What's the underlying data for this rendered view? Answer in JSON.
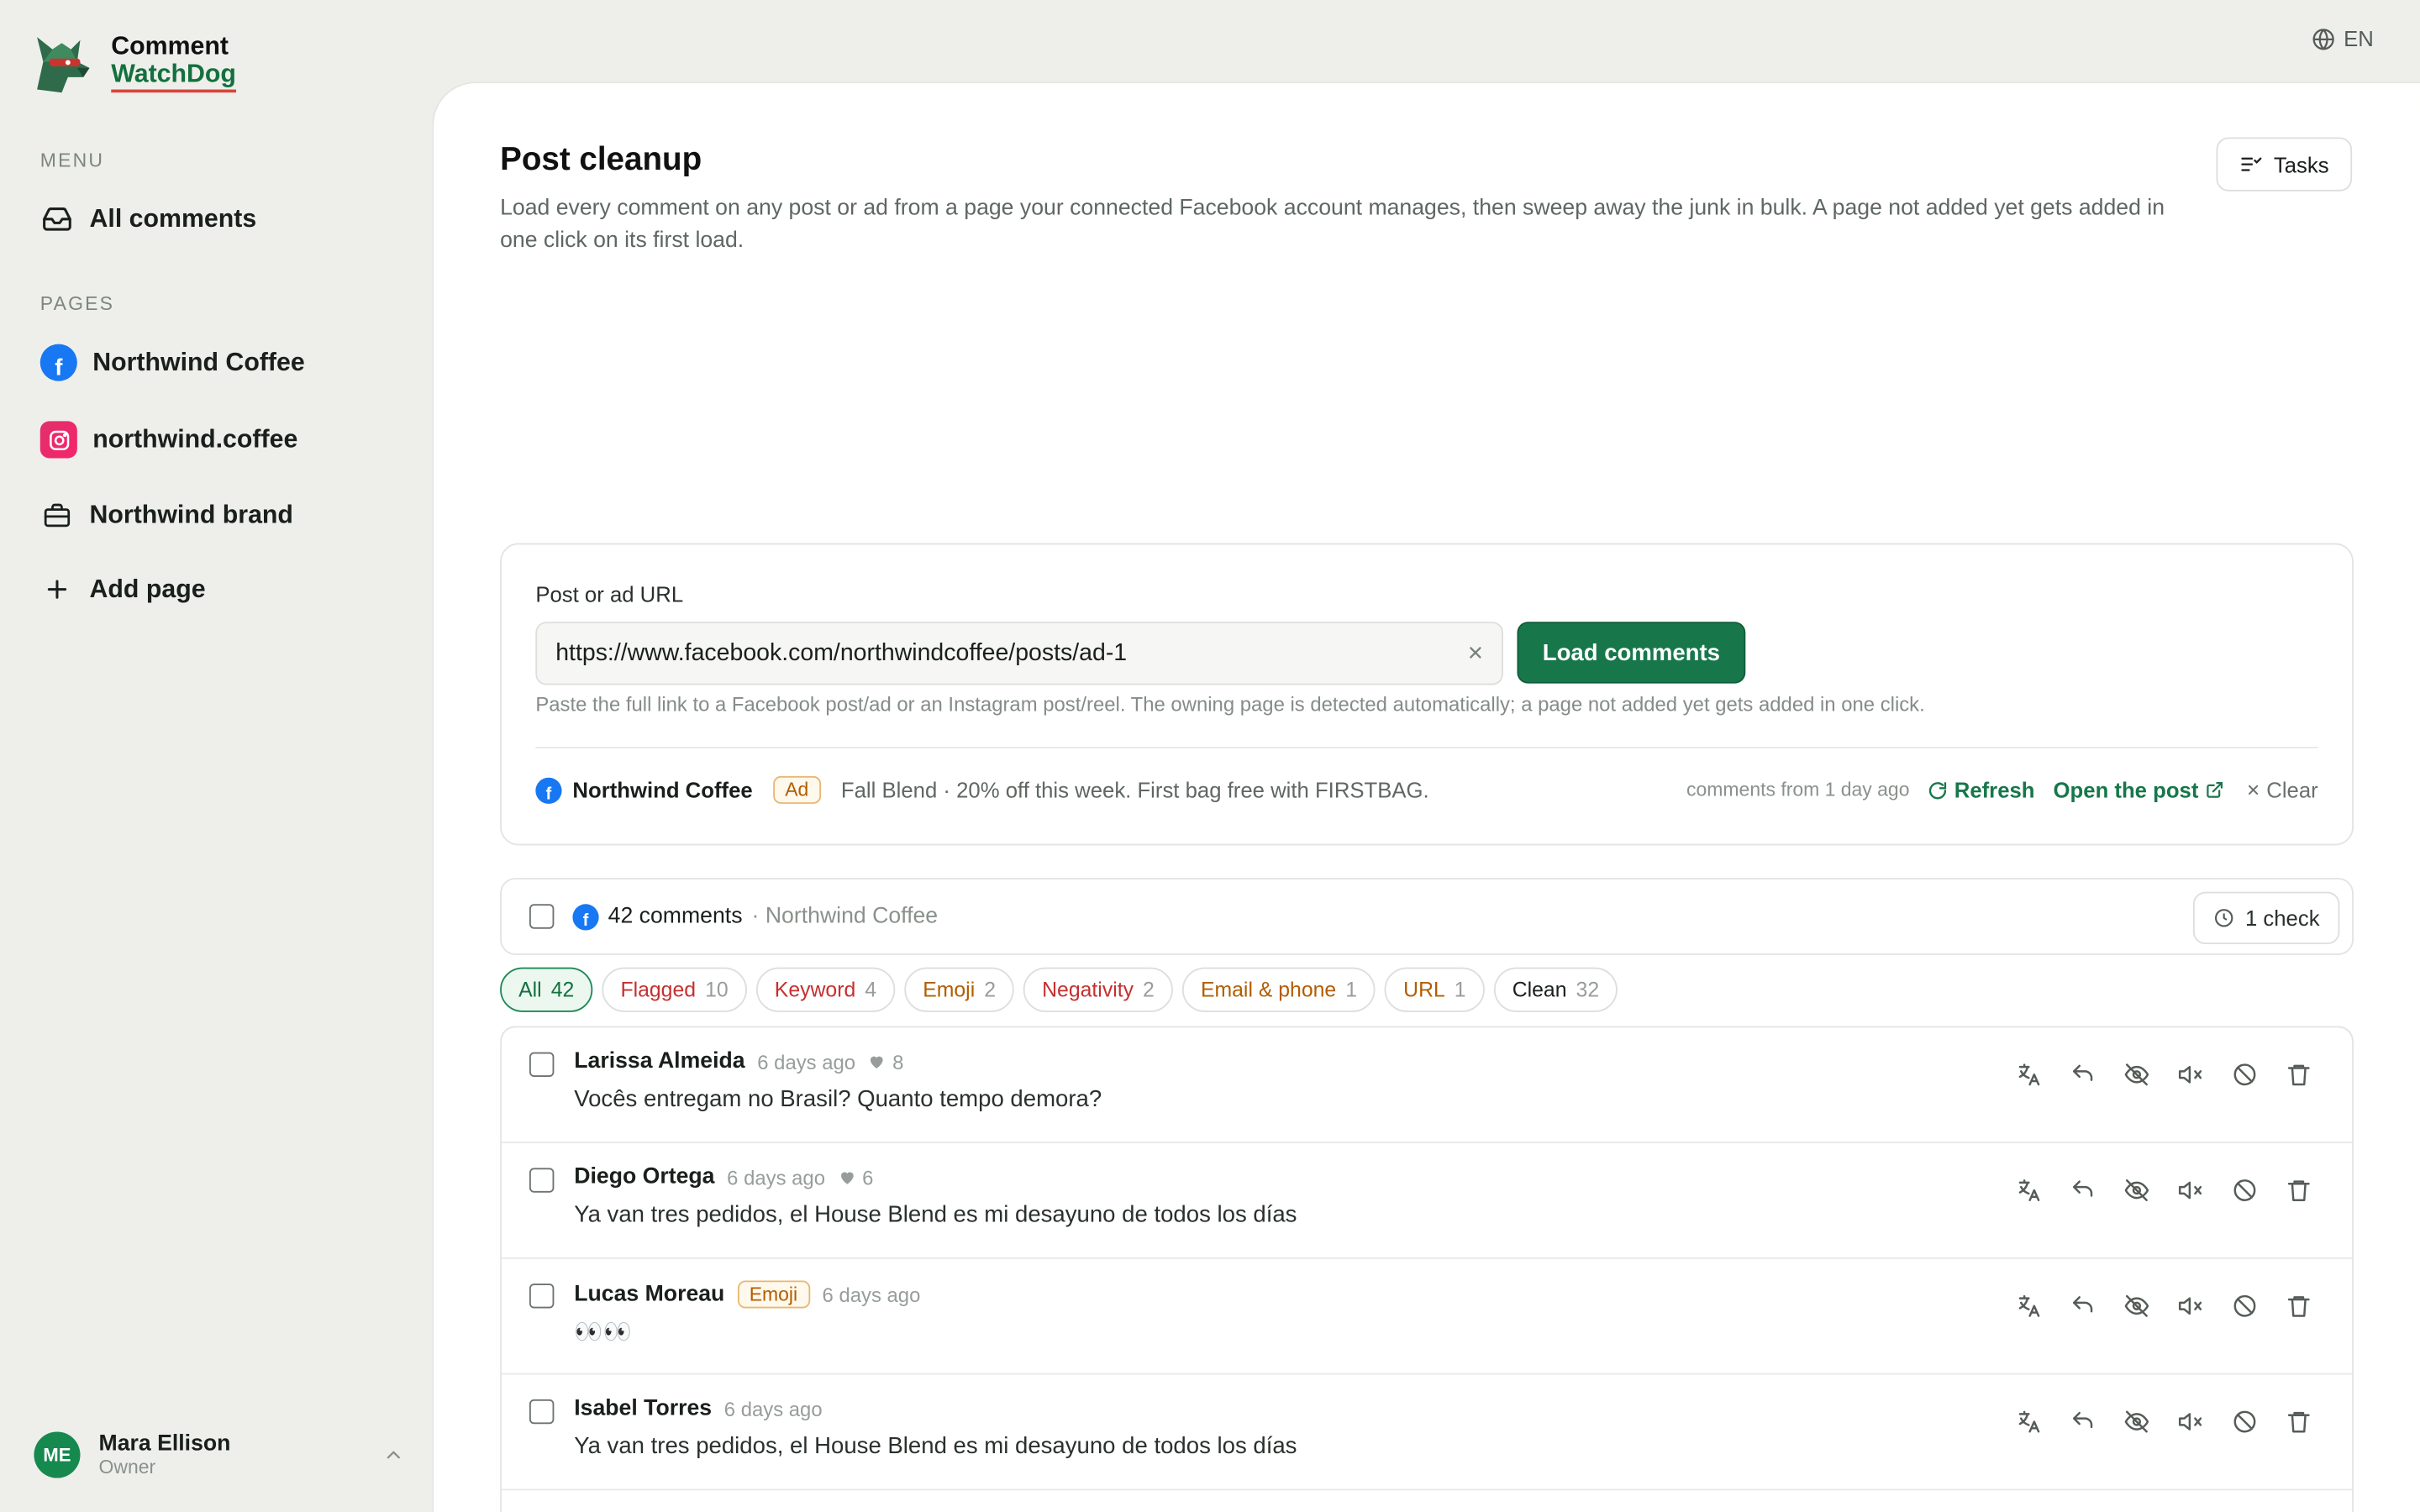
{
  "brand": {
    "line1": "Comment",
    "line2": "WatchDog"
  },
  "lang": {
    "label": "EN"
  },
  "sidebar": {
    "menu_label": "MENU",
    "all_comments": "All comments",
    "pages_label": "PAGES",
    "pages": [
      {
        "name": "Northwind Coffee",
        "type": "facebook"
      },
      {
        "name": "northwind.coffee",
        "type": "instagram"
      },
      {
        "name": "Northwind brand",
        "type": "brand"
      }
    ],
    "add_page": "Add page",
    "user": {
      "initials": "ME",
      "name": "Mara Ellison",
      "role": "Owner"
    }
  },
  "header": {
    "title": "Post cleanup",
    "description": "Load every comment on any post or ad from a page your connected Facebook account manages, then sweep away the junk in bulk. A page not added yet gets added in one click on its first load.",
    "tasks_label": "Tasks"
  },
  "url_card": {
    "label": "Post or ad URL",
    "value": "https://www.facebook.com/northwindcoffee/posts/ad-1",
    "load_label": "Load comments",
    "help": "Paste the full link to a Facebook post/ad or an Instagram post/reel. The owning page is detected automatically; a page not added yet gets added in one click.",
    "post": {
      "page": "Northwind Coffee",
      "badge": "Ad",
      "text": "Fall Blend · 20% off this week. First bag free with FIRSTBAG.",
      "meta": "comments from 1 day ago",
      "refresh": "Refresh",
      "open": "Open the post",
      "clear": "Clear"
    }
  },
  "comments_bar": {
    "count": "42 comments",
    "page": "· Northwind Coffee",
    "check_label": "1 check"
  },
  "filters": [
    {
      "label": "All",
      "count": "42",
      "color": "#14703e"
    },
    {
      "label": "Flagged",
      "count": "10",
      "color": "#c62f2f"
    },
    {
      "label": "Keyword",
      "count": "4",
      "color": "#c62f2f"
    },
    {
      "label": "Emoji",
      "count": "2",
      "color": "#b25d00"
    },
    {
      "label": "Negativity",
      "count": "2",
      "color": "#c62f2f"
    },
    {
      "label": "Email & phone",
      "count": "1",
      "color": "#b25d00"
    },
    {
      "label": "URL",
      "count": "1",
      "color": "#b25d00"
    },
    {
      "label": "Clean",
      "count": "32",
      "color": "#1a1f1c"
    }
  ],
  "comments": [
    {
      "author": "Larissa Almeida",
      "tag": "",
      "time": "6 days ago",
      "likes": "8",
      "text": "Vocês entregam no Brasil? Quanto tempo demora?"
    },
    {
      "author": "Diego Ortega",
      "tag": "",
      "time": "6 days ago",
      "likes": "6",
      "text": "Ya van tres pedidos, el House Blend es mi desayuno de todos los días"
    },
    {
      "author": "Lucas Moreau",
      "tag": "Emoji",
      "time": "6 days ago",
      "likes": "",
      "text": "👀👀"
    },
    {
      "author": "Isabel Torres",
      "tag": "",
      "time": "6 days ago",
      "likes": "",
      "text": "Ya van tres pedidos, el House Blend es mi desayuno de todos los días"
    }
  ]
}
